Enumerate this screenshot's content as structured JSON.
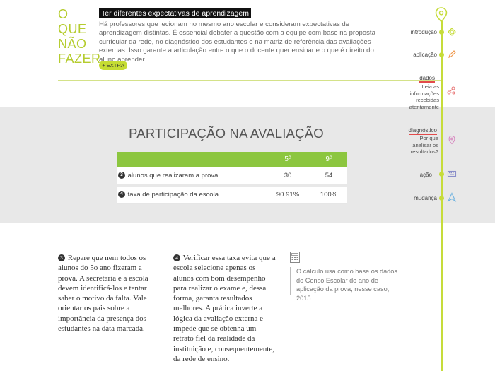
{
  "top": {
    "side_title_lines": [
      "O QUE",
      "NÃO",
      "FAZER"
    ],
    "heading": "Ter diferentes expectativas de aprendizagem",
    "body": "Há professores que lecionam no mesmo ano escolar e consideram expectativas de aprendizagem distintas. É essencial debater a questão com a equipe com base na proposta curricular da rede, no diagnóstico dos estudantes e na matriz de referência das avaliações externas. Isso garante a articulação entre o que o docente quer ensinar e o que é direito do aluno aprender.",
    "extra_button": "+ EXTRA"
  },
  "section": {
    "title": "PARTICIPAÇÃO NA AVALIAÇÃO",
    "table": {
      "columns": [
        "5º",
        "9º"
      ],
      "rows": [
        {
          "num": "3",
          "label": "alunos que realizaram a prova",
          "values": [
            "30",
            "54"
          ]
        },
        {
          "num": "4",
          "label": "taxa de participação da escola",
          "values": [
            "90.91%",
            "100%"
          ]
        }
      ]
    }
  },
  "notes": {
    "note1_num": "3",
    "note1": "Repare que nem todos os alunos do 5o ano fizeram a prova. A secretaria e a escola devem identificá-los e tentar saber o motivo da falta. Vale orientar os pais sobre a importância da presença dos estudantes na data marcada.",
    "note2_num": "4",
    "note2": "Verificar essa taxa evita que a escola selecione apenas os alunos com bom desempenho para realizar o exame e, dessa forma, garanta resultados melhores. A prática inverte a lógica da avaliação externa e impede que se obtenha um retrato fiel da realidade da instituição e, consequentemente, da rede de ensino.",
    "side": "O cálculo usa como base os dados do Censo Escolar do ano de aplicação da prova, nesse caso, 2015."
  },
  "nav": {
    "items": [
      {
        "label": "introdução",
        "icon": "diamond-icon"
      },
      {
        "label": "aplicação",
        "icon": "pencil-icon"
      },
      {
        "label": "dados",
        "icon": "nodes-icon",
        "sub": [
          "Leia as",
          "informações",
          "recebidas",
          "atentamente"
        ]
      },
      {
        "label": "diagnóstico",
        "icon": "location-pin-icon",
        "sub": [
          "Por que",
          "analisar os",
          "resultados?"
        ]
      },
      {
        "label": "ação",
        "icon": "keyboard-icon"
      },
      {
        "label": "mudança",
        "icon": "arrow-up-icon"
      }
    ]
  },
  "colors": {
    "accent": "#c6dc3a",
    "table_head": "#8cc63f",
    "band": "#e8e8e8"
  }
}
